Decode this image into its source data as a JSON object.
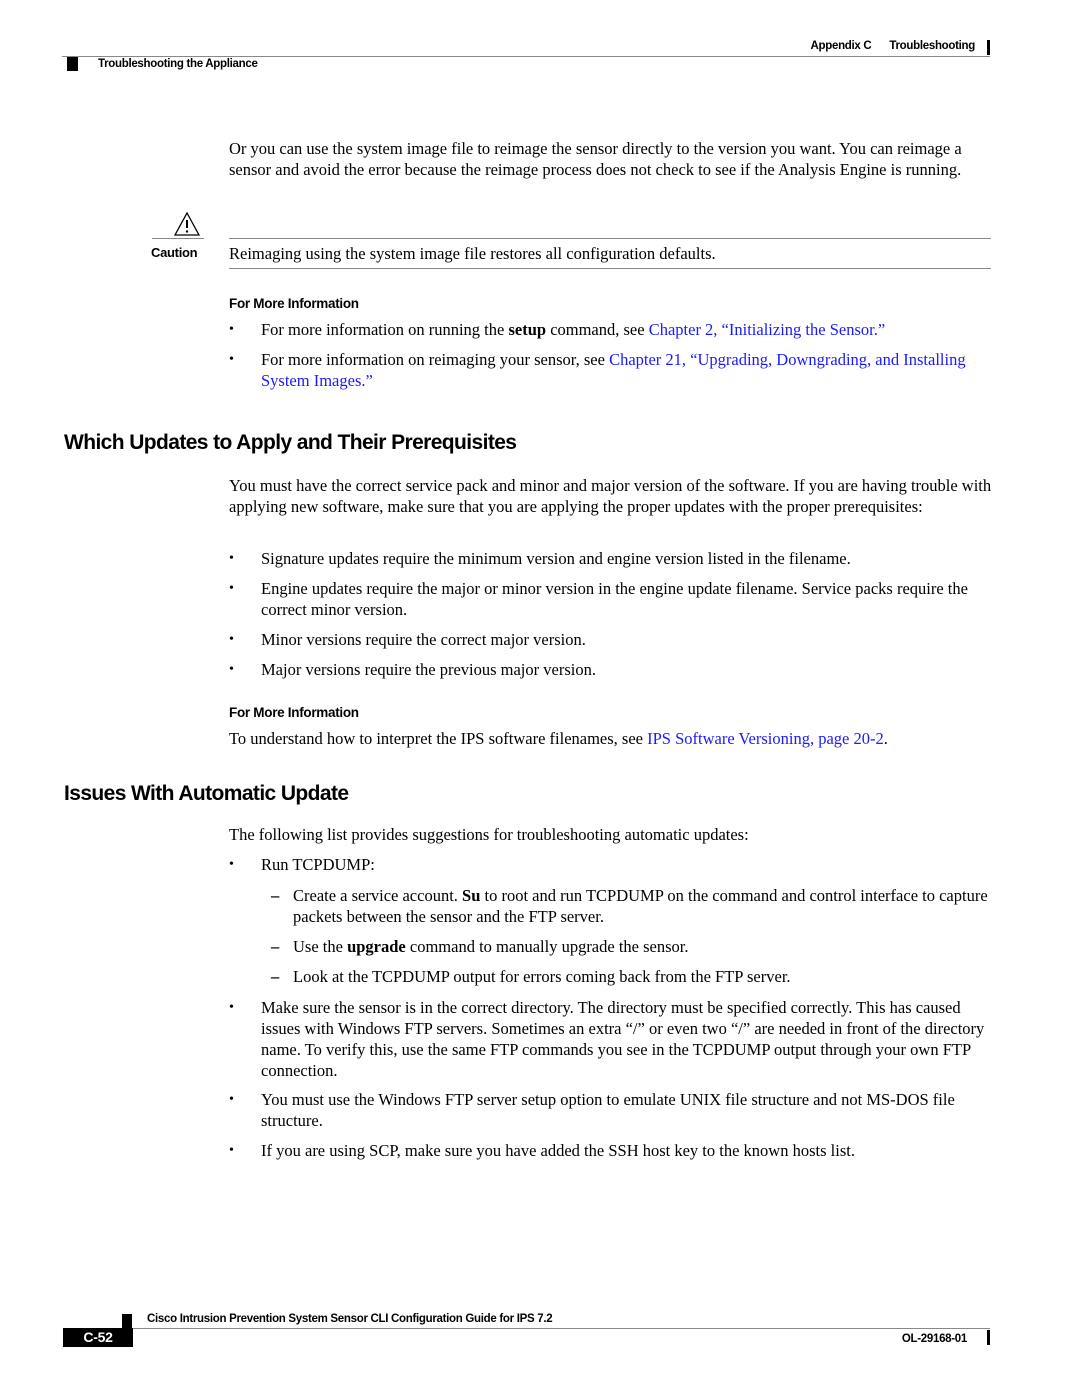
{
  "header": {
    "chapter": "Appendix C",
    "chapter_title": "Troubleshooting",
    "section": "Troubleshooting the Appliance"
  },
  "intro_paragraph": "Or you can use the system image file to reimage the sensor directly to the version you want. You can reimage a sensor and avoid the error because the reimage process does not check to see if the Analysis Engine is running.",
  "caution": {
    "icon": "warning-triangle-icon",
    "label": "Caution",
    "text": "Reimaging using the system image file restores all configuration defaults."
  },
  "more_info_1": {
    "heading": "For More Information",
    "items": [
      {
        "pre": "For more information on running the ",
        "bold": "setup",
        "mid": " command, see ",
        "link": "Chapter 2, “Initializing the Sensor.”"
      },
      {
        "pre": "For more information on reimaging your sensor, see ",
        "link": "Chapter 21, “Upgrading, Downgrading, and Installing System Images.”"
      }
    ]
  },
  "section_which": {
    "title": "Which Updates to Apply and Their Prerequisites",
    "paragraph": "You must have the correct service pack and minor and major version of the software. If you are having trouble with applying new software, make sure that you are applying the proper updates with the proper prerequisites:",
    "bullets": [
      "Signature updates require the minimum version and engine version listed in the filename.",
      "Engine updates require the major or minor version in the engine update filename. Service packs require the correct minor version.",
      "Minor versions require the correct major version.",
      "Major versions require the previous major version."
    ],
    "more_info": {
      "heading": "For More Information",
      "pre": "To understand how to interpret the IPS software filenames, see ",
      "link": "IPS Software Versioning, page 20-2",
      "post": "."
    }
  },
  "section_issues": {
    "title": "Issues With Automatic Update",
    "paragraph": "The following list provides suggestions for troubleshooting automatic updates:",
    "bullet_run": "Run TCPDUMP:",
    "sub_items": [
      {
        "pre": "Create a service account. ",
        "bold": "Su",
        "post": " to root and run TCPDUMP on the command and control interface to capture packets between the sensor and the FTP server."
      },
      {
        "pre": "Use the ",
        "bold": "upgrade",
        "post": " command to manually upgrade the sensor."
      },
      {
        "pre": "Look at the TCPDUMP output for errors coming back from the FTP server.",
        "bold": "",
        "post": ""
      }
    ],
    "bullets": [
      "Make sure the sensor is in the correct directory. The directory must be specified correctly. This has caused issues with Windows FTP servers. Sometimes an extra “/” or even two “/” are needed in front of the directory name. To verify this, use the same FTP commands you see in the TCPDUMP output through your own FTP connection.",
      "You must use the Windows FTP server setup option to emulate UNIX file structure and not MS-DOS file structure.",
      "If you are using SCP, make sure you have added the SSH host key to the known hosts list."
    ]
  },
  "footer": {
    "guide_title": "Cisco Intrusion Prevention System Sensor CLI Configuration Guide for IPS 7.2",
    "page_number": "C-52",
    "doc_number": "OL-29168-01"
  },
  "colors": {
    "link": "#1a1aff",
    "rule": "#888888",
    "text": "#000000"
  }
}
